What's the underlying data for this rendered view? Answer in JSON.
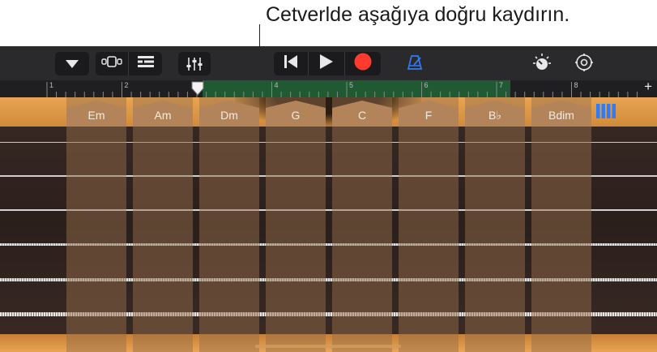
{
  "callout": {
    "text": "Cetverlde aşağıya doğru kaydırın."
  },
  "toolbar": {
    "icons": [
      "chevron-down-icon",
      "browser-icon",
      "tracks-view-icon",
      "mixer-icon",
      "go-to-beginning-icon",
      "play-icon",
      "record-icon",
      "metronome-icon",
      "master-effects-icon",
      "settings-icon"
    ],
    "record_color": "#ff3b30",
    "metronome_color": "#2f7cf6"
  },
  "ruler": {
    "bars": [
      "1",
      "2",
      "3",
      "4",
      "5",
      "6",
      "7",
      "8"
    ],
    "add_label": "+",
    "highlight_color": "#1f5a33"
  },
  "chords": [
    {
      "label": "Em"
    },
    {
      "label": "Am"
    },
    {
      "label": "Dm"
    },
    {
      "label": "G"
    },
    {
      "label": "C"
    },
    {
      "label": "F"
    },
    {
      "label": "B♭"
    },
    {
      "label": "Bdim"
    }
  ],
  "grid_icon": "chord-strips-icon",
  "accent_color": "#2f7cf6"
}
